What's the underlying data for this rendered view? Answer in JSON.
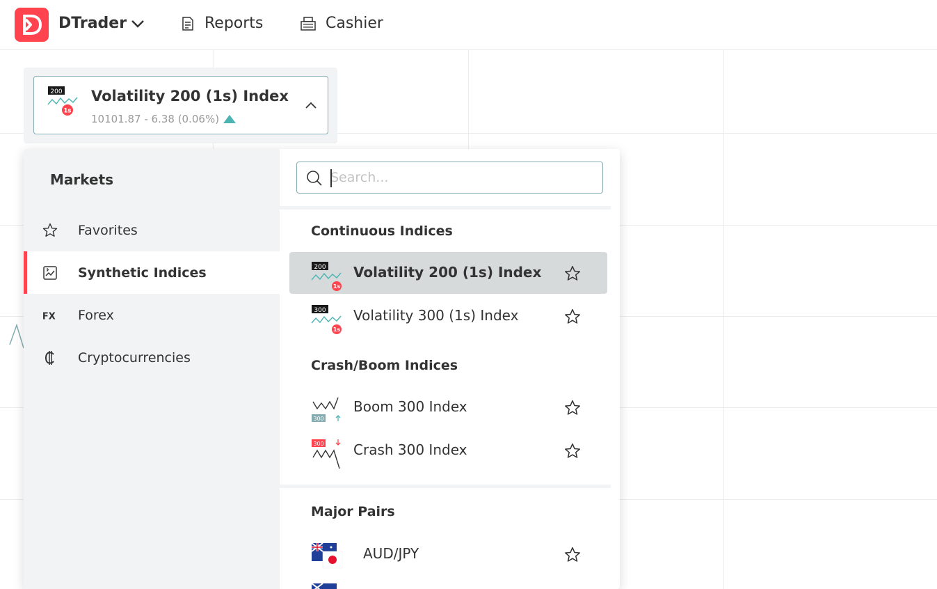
{
  "header": {
    "app_title": "DTrader",
    "nav": [
      {
        "label": "Reports",
        "icon": "reports-icon"
      },
      {
        "label": "Cashier",
        "icon": "cashier-icon"
      }
    ],
    "brand_color": "#ff444f"
  },
  "symbol": {
    "name": "Volatility 200 (1s) Index",
    "quote": "10101.87 - 6.38 (0.06%)",
    "icon_badge": "200",
    "icon_sub_badge": "1s",
    "trend": "up",
    "trend_color": "#4bb4b3"
  },
  "markets": {
    "title": "Markets",
    "categories": [
      {
        "label": "Favorites",
        "icon": "star-icon",
        "active": false
      },
      {
        "label": "Synthetic Indices",
        "icon": "synthetic-indices-icon",
        "active": true
      },
      {
        "label": "Forex",
        "icon": "forex-icon",
        "active": false
      },
      {
        "label": "Cryptocurrencies",
        "icon": "crypto-icon",
        "active": false
      }
    ]
  },
  "search": {
    "placeholder": "Search...",
    "value": ""
  },
  "groups": [
    {
      "title": "Continuous Indices",
      "items": [
        {
          "label": "Volatility 200 (1s) Index",
          "badge": "200",
          "sub_badge": "1s",
          "selected": true
        },
        {
          "label": "Volatility 300 (1s) Index",
          "badge": "300",
          "sub_badge": "1s",
          "selected": false
        }
      ]
    },
    {
      "title": "Crash/Boom Indices",
      "items": [
        {
          "label": "Boom 300 Index",
          "badge": "300",
          "selected": false
        },
        {
          "label": "Crash 300 Index",
          "badge": "300",
          "selected": false
        }
      ]
    },
    {
      "title": "Major Pairs",
      "items": [
        {
          "label": "AUD/JPY",
          "selected": false
        }
      ]
    }
  ]
}
